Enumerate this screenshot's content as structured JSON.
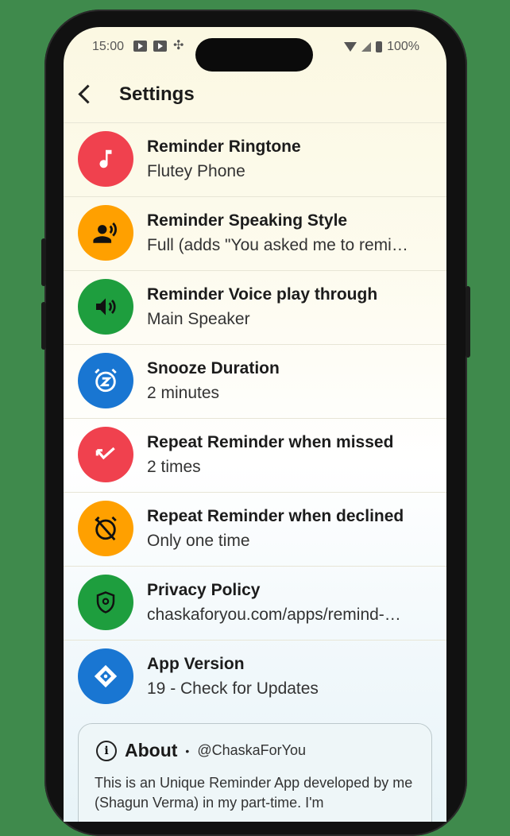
{
  "status_bar": {
    "time": "15:00",
    "battery": "100%"
  },
  "header": {
    "title": "Settings"
  },
  "settings": [
    {
      "title": "Reminder Ringtone",
      "value": "Flutey Phone",
      "icon": "music-note-icon",
      "color": "#f0414e"
    },
    {
      "title": "Reminder Speaking Style",
      "value": "Full (adds \"You asked me to remi…",
      "icon": "speaking-person-icon",
      "color": "#ffa000"
    },
    {
      "title": "Reminder Voice play through",
      "value": "Main Speaker",
      "icon": "speaker-icon",
      "color": "#1e9e3e"
    },
    {
      "title": "Snooze Duration",
      "value": "2 minutes",
      "icon": "snooze-alarm-icon",
      "color": "#1976d2"
    },
    {
      "title": "Repeat Reminder when missed",
      "value": "2 times",
      "icon": "missed-call-icon",
      "color": "#f0414e"
    },
    {
      "title": "Repeat Reminder when declined",
      "value": "Only one time",
      "icon": "alarm-off-icon",
      "color": "#ffa000"
    },
    {
      "title": "Privacy Policy",
      "value": "chaskaforyou.com/apps/remind-…",
      "icon": "privacy-shield-icon",
      "color": "#1e9e3e"
    },
    {
      "title": "App Version",
      "value": "19 - Check for Updates",
      "icon": "app-diamond-icon",
      "color": "#1976d2"
    }
  ],
  "about": {
    "title": "About",
    "separator": "•",
    "handle": "@ChaskaForYou",
    "text": "This is an Unique Reminder App developed by me (Shagun Verma) in my part-time. I'm"
  }
}
